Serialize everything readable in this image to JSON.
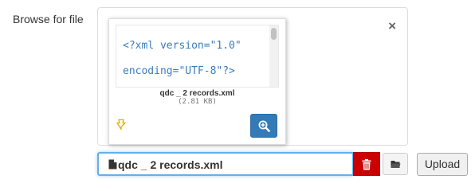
{
  "form": {
    "label": "Browse for file"
  },
  "preview": {
    "close_symbol": "×",
    "code_line1": "<?xml version=\"1.0\"",
    "code_line2": "encoding=\"UTF-8\"?>",
    "file_name": "qdc _ 2 records.xml",
    "file_size": "(2.81 KB)",
    "drag_icon": "drag-handle-icon",
    "zoom_icon": "zoom-in-icon"
  },
  "input_group": {
    "caption_text": "qdc _ 2 records.xml",
    "file_icon": "file-icon",
    "remove_icon": "trash-icon",
    "browse_icon": "folder-open-icon",
    "upload_label": "Upload"
  },
  "colors": {
    "code_text": "#3a7dbf",
    "zoom_button": "#337ab7",
    "remove_button": "#cc0000",
    "focus_border": "#66afe9",
    "drag_icon": "#e0b000"
  }
}
